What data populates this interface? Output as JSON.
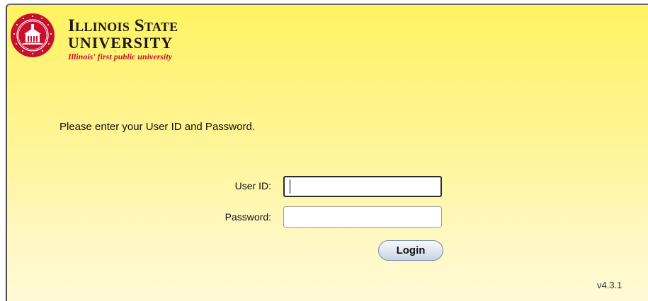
{
  "brand": {
    "line1": "Illinois State",
    "line2": "UNIVERSITY",
    "tagline": "Illinois' first public university",
    "seal_text": "ILLINOIS STATE UNIVERSITY",
    "red": "#c8102e"
  },
  "login": {
    "instructions": "Please enter your User ID and Password.",
    "user_label": "User ID:",
    "user_value": "",
    "password_label": "Password:",
    "password_value": "",
    "button_label": "Login"
  },
  "footer": {
    "version": "v4.3.1"
  }
}
